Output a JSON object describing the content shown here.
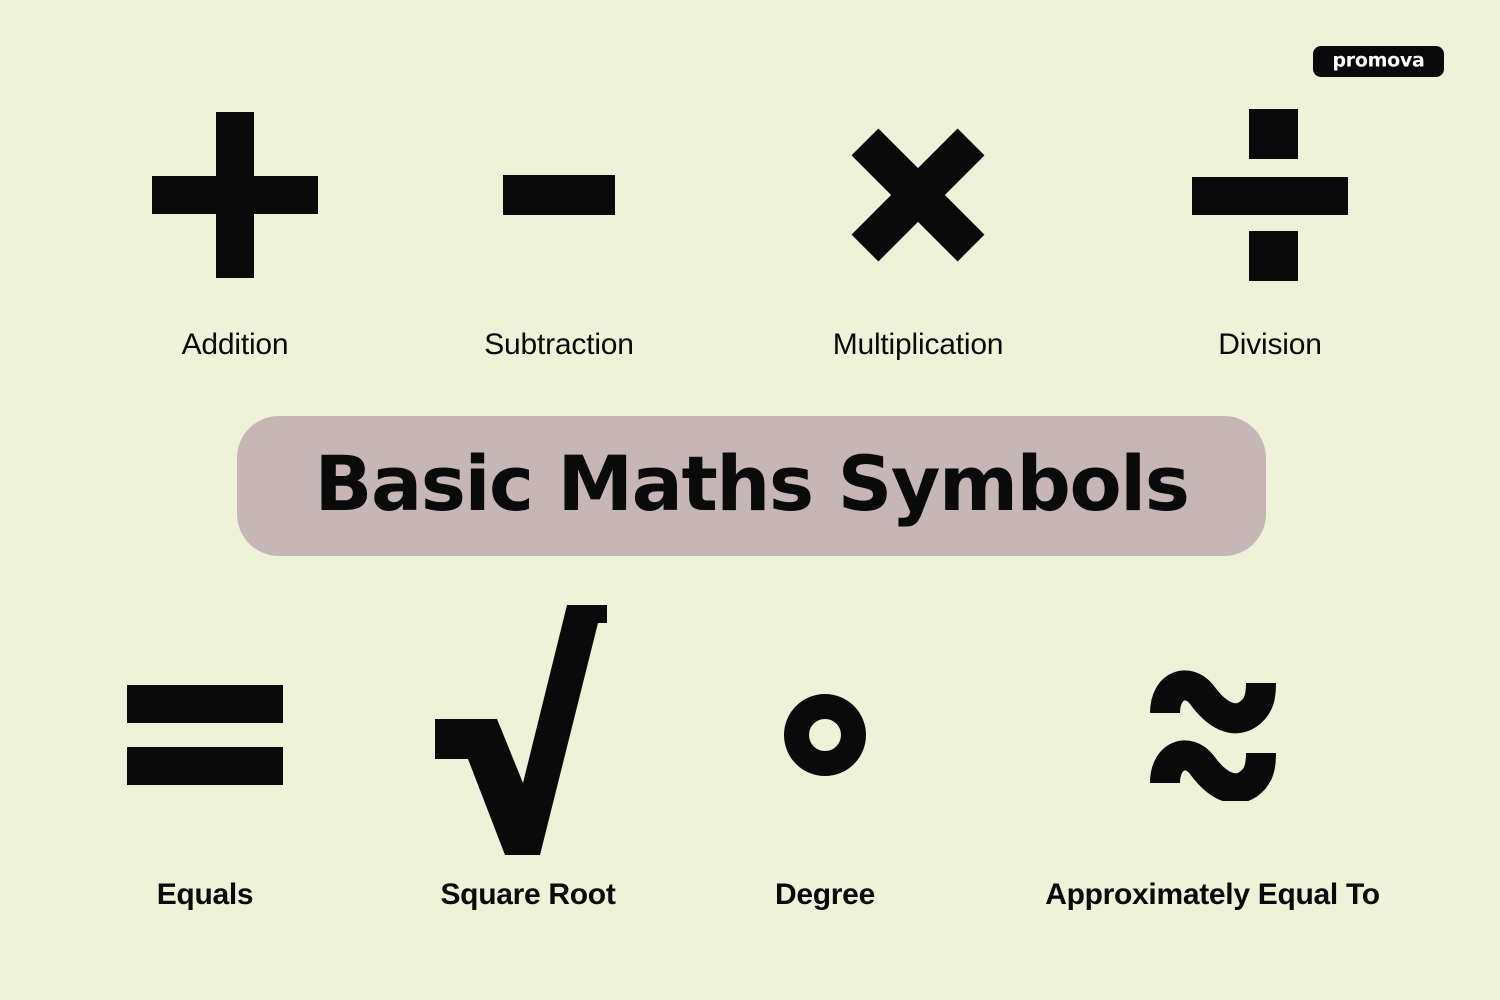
{
  "page": {
    "background_color": "#EDF2D9",
    "title_text": "Basic Maths Symbols"
  },
  "brand": {
    "name": "promova",
    "badge_color": "#0A0A0A",
    "text_color": "#FFFFFF"
  },
  "banner": {
    "label": "Basic Maths Symbols",
    "background_color": "#C6B6B6",
    "text_color": "#0A0A0A"
  },
  "symbols": {
    "top_row": [
      {
        "glyph": "+",
        "icon": "plus-icon",
        "label": "Addition"
      },
      {
        "glyph": "−",
        "icon": "minus-icon",
        "label": "Subtraction"
      },
      {
        "glyph": "×",
        "icon": "multiply-icon",
        "label": "Multiplication"
      },
      {
        "glyph": "÷",
        "icon": "divide-icon",
        "label": "Division"
      }
    ],
    "bottom_row": [
      {
        "glyph": "=",
        "icon": "equals-icon",
        "label": "Equals"
      },
      {
        "glyph": "√",
        "icon": "square-root-icon",
        "label": "Square Root"
      },
      {
        "glyph": "°",
        "icon": "degree-icon",
        "label": "Degree"
      },
      {
        "glyph": "≈",
        "icon": "approximately-equal-icon",
        "label": "Approximately Equal To"
      }
    ]
  },
  "colors": {
    "symbol": "#0A0A0A",
    "background": "#EDF2D9",
    "banner": "#C6B6B6"
  }
}
